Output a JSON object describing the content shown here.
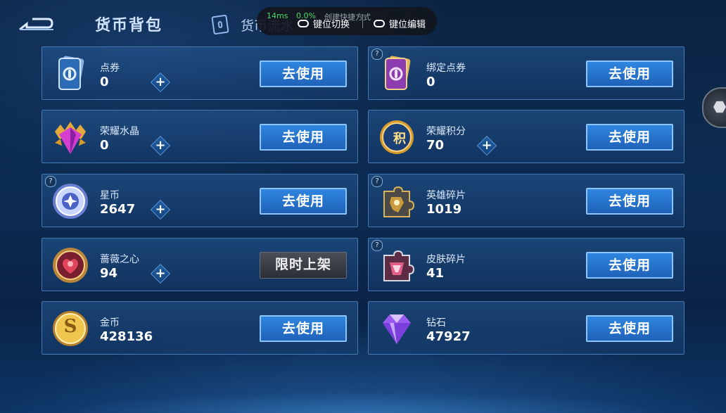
{
  "header": {
    "title": "货币背包",
    "flow_tab_label": "货币流水"
  },
  "overlay": {
    "ping": "14ms",
    "loss": "0.0%",
    "shortcut_hint": "创建快捷方式",
    "switch_label": "键位切换",
    "edit_label": "键位编辑"
  },
  "colors": {
    "accent": "#2f86e0",
    "button_border": "#8cc4ff",
    "card_border": "#6eaaeb",
    "latency_green": "#4cd964"
  },
  "currencies": [
    {
      "name": "点券",
      "value": "0",
      "icon": "voucher-card-icon",
      "button": "去使用",
      "has_plus": true,
      "has_help": false
    },
    {
      "name": "绑定点券",
      "value": "0",
      "icon": "bound-voucher-card-icon",
      "button": "去使用",
      "has_plus": false,
      "has_help": true
    },
    {
      "name": "荣耀水晶",
      "value": "0",
      "icon": "glory-crystal-icon",
      "button": "去使用",
      "has_plus": true,
      "has_help": false
    },
    {
      "name": "荣耀积分",
      "value": "70",
      "icon": "glory-points-icon",
      "button": "去使用",
      "has_plus": true,
      "has_help": false
    },
    {
      "name": "星币",
      "value": "2647",
      "icon": "star-coin-icon",
      "button": "去使用",
      "has_plus": true,
      "has_help": true
    },
    {
      "name": "英雄碎片",
      "value": "1019",
      "icon": "hero-fragment-icon",
      "button": "去使用",
      "has_plus": false,
      "has_help": true
    },
    {
      "name": "蔷薇之心",
      "value": "94",
      "icon": "rose-heart-icon",
      "button": "限时上架",
      "has_plus": true,
      "has_help": false,
      "button_disabled": true
    },
    {
      "name": "皮肤碎片",
      "value": "41",
      "icon": "skin-fragment-icon",
      "button": "去使用",
      "has_plus": false,
      "has_help": true
    },
    {
      "name": "金币",
      "value": "428136",
      "icon": "gold-coin-icon",
      "button": "去使用",
      "has_plus": false,
      "has_help": false
    },
    {
      "name": "钻石",
      "value": "47927",
      "icon": "diamond-icon",
      "button": "去使用",
      "has_plus": false,
      "has_help": false
    }
  ],
  "icon_glyphs": {
    "glory_points": "积",
    "gold_coin": "S",
    "help": "?",
    "plus": "+"
  }
}
